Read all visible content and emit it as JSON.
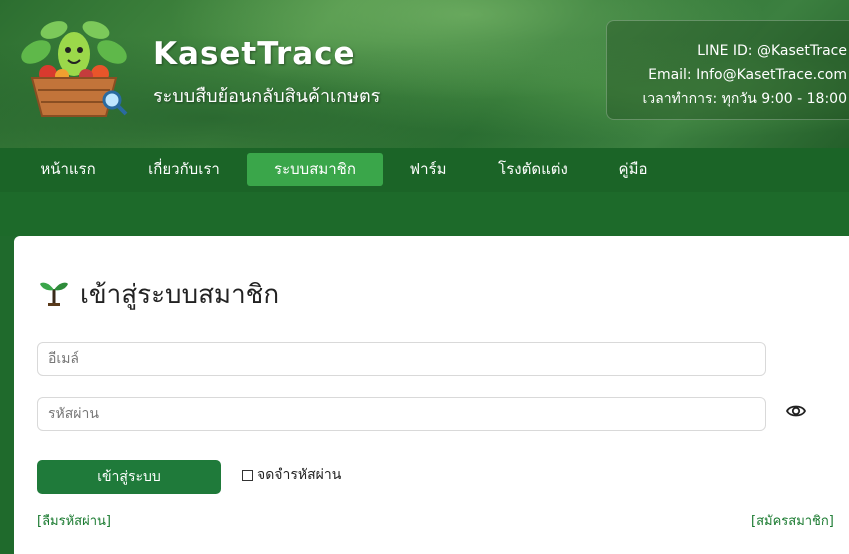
{
  "brand": {
    "title": "KasetTrace",
    "subtitle": "ระบบสืบย้อนกลับสินค้าเกษตร"
  },
  "contact": {
    "line": "LINE ID: @KasetTrace",
    "email": "Email: Info@KasetTrace.com",
    "hours": "เวลาทำการ: ทุกวัน 9:00 - 18:00"
  },
  "nav": {
    "items": [
      {
        "label": "หน้าแรก"
      },
      {
        "label": "เกี่ยวกับเรา"
      },
      {
        "label": "ระบบสมาชิก",
        "active": true
      },
      {
        "label": "ฟาร์ม"
      },
      {
        "label": "โรงตัดแต่ง"
      },
      {
        "label": "คู่มือ"
      }
    ]
  },
  "login": {
    "title": "เข้าสู่ระบบสมาชิก",
    "email_placeholder": "อีเมล์",
    "password_placeholder": "รหัสผ่าน",
    "submit_label": "เข้าสู่ระบบ",
    "remember_label": "จดจำรหัสผ่าน",
    "forgot_link": "[ลืมรหัสผ่าน]",
    "register_link": "[สมัครสมาชิก]"
  },
  "colors": {
    "primary": "#1f7a3a",
    "nav_bg": "#1b6427",
    "nav_active": "#3aa64a"
  }
}
